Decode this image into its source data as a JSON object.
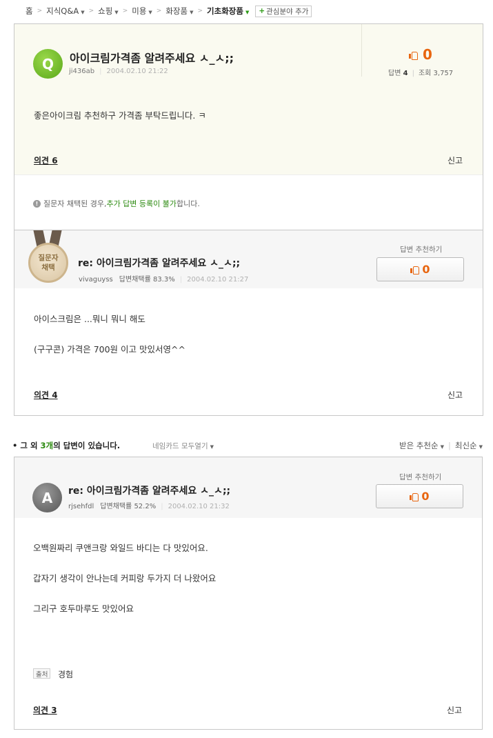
{
  "breadcrumb": {
    "items": [
      {
        "label": "홈",
        "dropdown": false
      },
      {
        "label": "지식Q&A",
        "dropdown": true
      },
      {
        "label": "쇼핑",
        "dropdown": true
      },
      {
        "label": "미용",
        "dropdown": true
      },
      {
        "label": "화장품",
        "dropdown": true
      },
      {
        "label": "기초화장품",
        "dropdown": true
      }
    ],
    "add_interest": "관심분야 추가"
  },
  "question": {
    "icon_letter": "Q",
    "title": "아이크림가격좀 알려주세요 ㅅ_ㅅ;;",
    "author": "ji436ab",
    "date": "2004.02.10 21:22",
    "recommend_count": "0",
    "answers_label": "답변",
    "answers_count": "4",
    "views_label": "조회",
    "views_count": "3,757",
    "body": "좋은아이크림 추천하구 가격좀 부탁드립니다. ㅋ",
    "opinion_label": "의견 6",
    "report_label": "신고"
  },
  "notice": {
    "prefix": "질문자 채택된 경우, ",
    "highlight": "추가 답변 등록이 불가",
    "suffix": "합니다."
  },
  "chosen_answer": {
    "medal_line1": "질문자",
    "medal_line2": "채택",
    "title": "re: 아이크림가격좀 알려주세요 ㅅ_ㅅ;;",
    "author": "vivaguyss",
    "adopt_rate_label": "답변채택률",
    "adopt_rate": "83.3%",
    "date": "2004.02.10 21:27",
    "recommend_label": "답변 추천하기",
    "recommend_count": "0",
    "lines": [
      "아이스크림은 ...뭐니 뭐니 해도",
      "(구구콘) 가격은 700원 이고 맛있서영^^"
    ],
    "opinion_label": "의견 4",
    "report_label": "신고"
  },
  "others": {
    "prefix": "그 외 ",
    "count": "3개",
    "suffix": "의 답변이 있습니다.",
    "namecard": "네임카드 모두열기",
    "sort_recommend": "받은 추천순",
    "sort_latest": "최신순"
  },
  "answer2": {
    "icon_letter": "A",
    "title": "re: 아이크림가격좀 알려주세요 ㅅ_ㅅ;;",
    "author": "rjsehfdl",
    "adopt_rate_label": "답변채택률",
    "adopt_rate": "52.2%",
    "date": "2004.02.10 21:32",
    "recommend_label": "답변 추천하기",
    "recommend_count": "0",
    "lines": [
      "오백원짜리 쿠앤크랑 와일드 바디는 다 맛있어요.",
      "갑자기 생각이 안나는데 커피랑 두가지 더 나왔어요",
      "그리구 호두마루도 맛있어요"
    ],
    "source_tag": "출처",
    "source_value": "경험",
    "opinion_label": "의견 3",
    "report_label": "신고"
  },
  "colors": {
    "accent_orange": "#e8650f",
    "accent_green": "#2c8a10",
    "question_bg": "#fafaf0"
  }
}
